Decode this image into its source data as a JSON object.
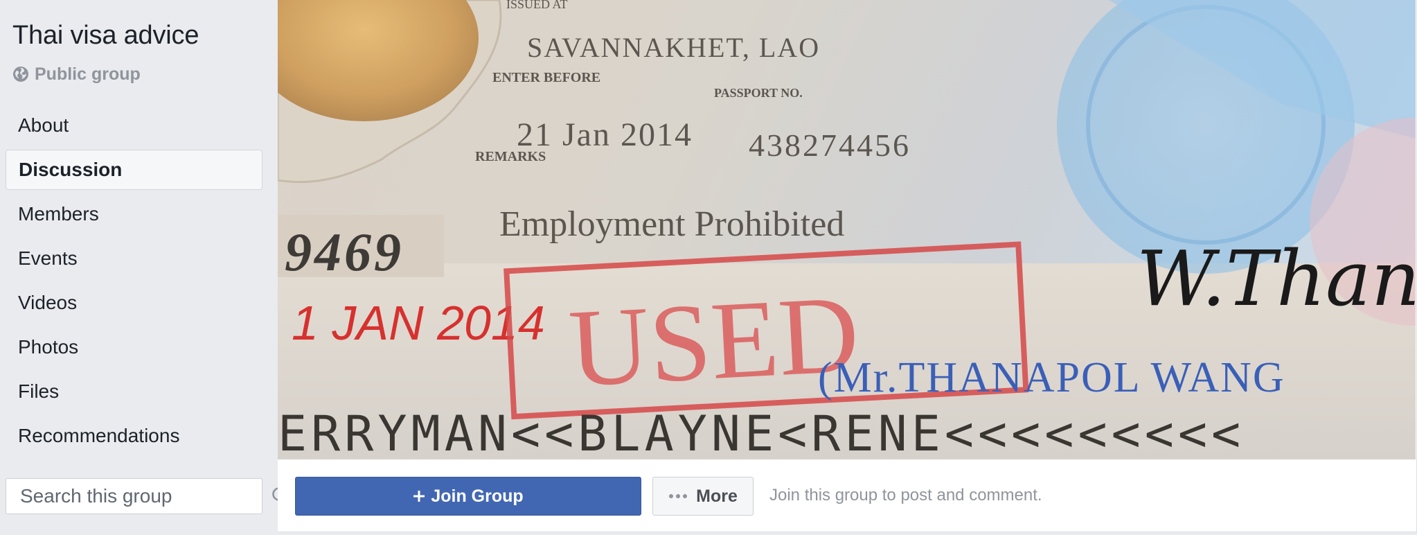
{
  "group": {
    "title": "Thai visa advice",
    "privacy": "Public group"
  },
  "nav": {
    "items": [
      {
        "label": "About"
      },
      {
        "label": "Discussion",
        "active": true
      },
      {
        "label": "Members"
      },
      {
        "label": "Events"
      },
      {
        "label": "Videos"
      },
      {
        "label": "Photos"
      },
      {
        "label": "Files"
      },
      {
        "label": "Recommendations"
      }
    ]
  },
  "search": {
    "placeholder": "Search this group"
  },
  "cover": {
    "text": {
      "issued_at": "ISSUED AT",
      "place": "SAVANNAKHET, LAO",
      "enter_before": "ENTER BEFORE",
      "passport_no_label": "PASSPORT NO.",
      "date": "21 Jan 2014",
      "passport_no": "438274456",
      "remarks": "REMARKS",
      "employment": "Employment Prohibited",
      "number": "9469",
      "red_date": "1 JAN 2014",
      "stamp": "USED",
      "name": "(Mr.THANAPOL WANG",
      "mrz": "ERRYMAN<<BLAYNE<RENE<<<<<<<<<",
      "signature": "W.Thanap"
    }
  },
  "actions": {
    "join_label": "Join Group",
    "more_label": "More",
    "hint": "Join this group to post and comment."
  },
  "colors": {
    "brand": "#4267b2",
    "background": "#e9ebee"
  }
}
